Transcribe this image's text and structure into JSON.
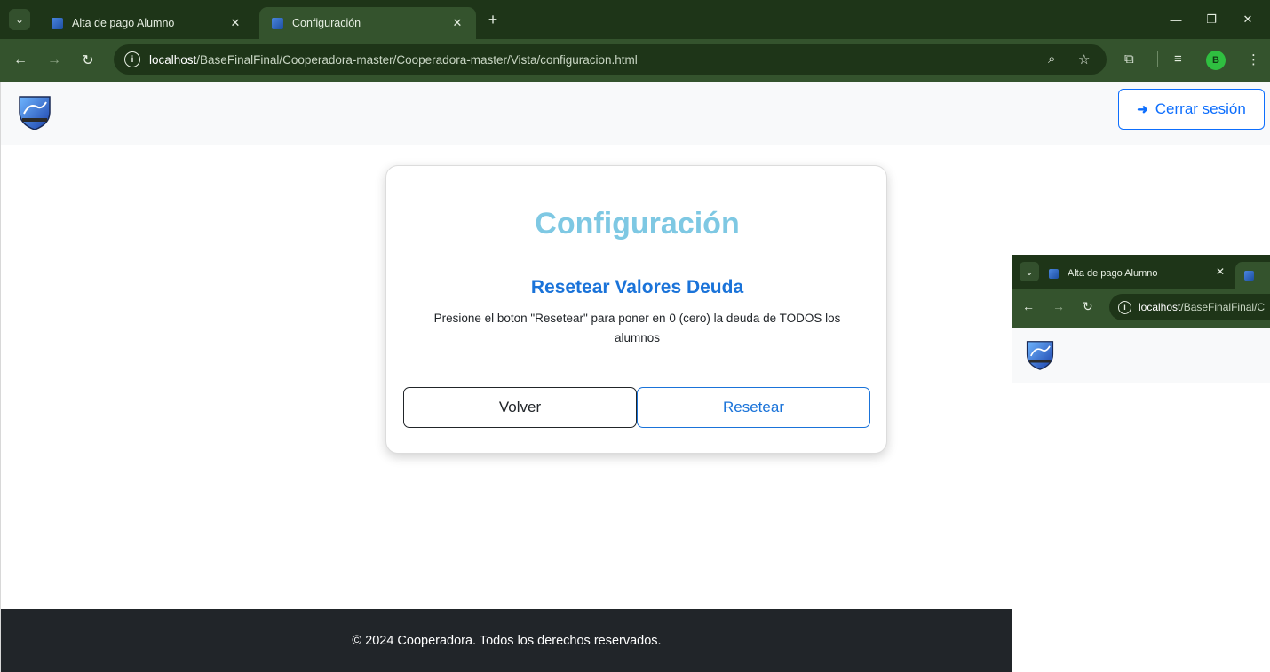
{
  "browser": {
    "tabs": [
      {
        "title": "Alta de pago Alumno",
        "active": false
      },
      {
        "title": "Configuración",
        "active": true
      }
    ],
    "url_host": "localhost",
    "url_path": "/BaseFinalFinal/Cooperadora-master/Cooperadora-master/Vista/configuracion.html",
    "profile_initial": "B",
    "icons": {
      "tab_search": "chevron-down-icon",
      "tab_close": "close-icon",
      "new_tab": "plus-icon",
      "minimize": "minimize-icon",
      "restore": "restore-icon",
      "close_window": "close-icon",
      "back": "arrow-left-icon",
      "forward": "arrow-right-icon",
      "reload": "reload-icon",
      "site_info": "info-icon",
      "zoom": "zoom-icon",
      "bookmark": "star-icon",
      "extensions": "puzzle-icon",
      "media": "media-queue-icon",
      "menu": "kebab-menu-icon"
    }
  },
  "navbar": {
    "logout_label": "Cerrar sesión",
    "logout_icon": "sign-out-icon"
  },
  "card": {
    "title": "Configuración",
    "subtitle": "Resetear Valores Deuda",
    "description": "Presione el boton \"Resetear\" para poner en 0 (cero) la deuda de TODOS los alumnos",
    "back_label": "Volver",
    "reset_label": "Resetear"
  },
  "footer": {
    "text": "© 2024 Cooperadora. Todos los derechos reservados."
  },
  "thumbnail": {
    "tab_title": "Alta de pago Alumno",
    "url_host": "localhost",
    "url_path": "/BaseFinalFinal/C"
  },
  "colors": {
    "chrome_dark": "#1e3518",
    "chrome_light": "#34532d",
    "primary": "#0d6efd",
    "title": "#7ec8e3",
    "footer_bg": "#212529"
  }
}
